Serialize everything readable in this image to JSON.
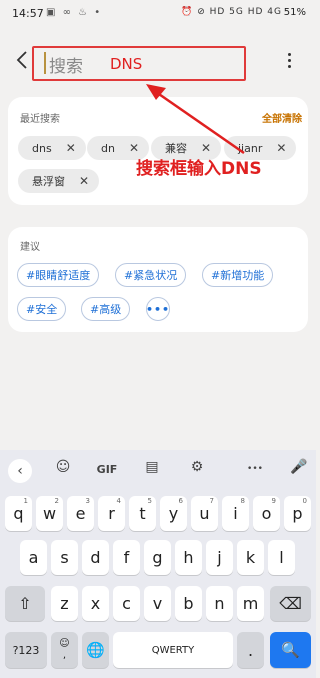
{
  "status_bar": {
    "time": "14:57",
    "left_icons": "▣ ∞ ♨ •",
    "right_icons": "⏰ ⊘ HD 5G HD 4G",
    "battery": "51%"
  },
  "header": {
    "search_placeholder": "搜索",
    "annotation_label": "DNS"
  },
  "recent": {
    "title": "最近搜索",
    "clear_all": "全部清除",
    "chips": [
      "dns",
      "dn",
      "兼容",
      "jianr",
      "悬浮窗"
    ]
  },
  "annotation": {
    "text": "搜索框输入DNS",
    "color": "#e02020"
  },
  "suggestions": {
    "title": "建议",
    "tags": [
      "#眼睛舒适度",
      "#紧急状况",
      "#新增功能",
      "#安全",
      "#高级"
    ],
    "more": "•••"
  },
  "keyboard": {
    "toolbar": [
      "‹",
      "☺",
      "GIF",
      "▤",
      "⚙",
      "•••",
      "🎤"
    ],
    "row1": [
      {
        "key": "q",
        "hint": "1"
      },
      {
        "key": "w",
        "hint": "2"
      },
      {
        "key": "e",
        "hint": "3"
      },
      {
        "key": "r",
        "hint": "4"
      },
      {
        "key": "t",
        "hint": "5"
      },
      {
        "key": "y",
        "hint": "6"
      },
      {
        "key": "u",
        "hint": "7"
      },
      {
        "key": "i",
        "hint": "8"
      },
      {
        "key": "o",
        "hint": "9"
      },
      {
        "key": "p",
        "hint": "0"
      }
    ],
    "row2": [
      "a",
      "s",
      "d",
      "f",
      "g",
      "h",
      "j",
      "k",
      "l"
    ],
    "row3": [
      "z",
      "x",
      "c",
      "v",
      "b",
      "n",
      "m"
    ],
    "shift": "⇧",
    "backspace": "⌫",
    "symbols": "?123",
    "emoji_comma": "☺\n,",
    "globe": "🌐",
    "space": "QWERTY",
    "period": ".",
    "search": "🔍",
    "accent_color": "#1e78f0"
  }
}
